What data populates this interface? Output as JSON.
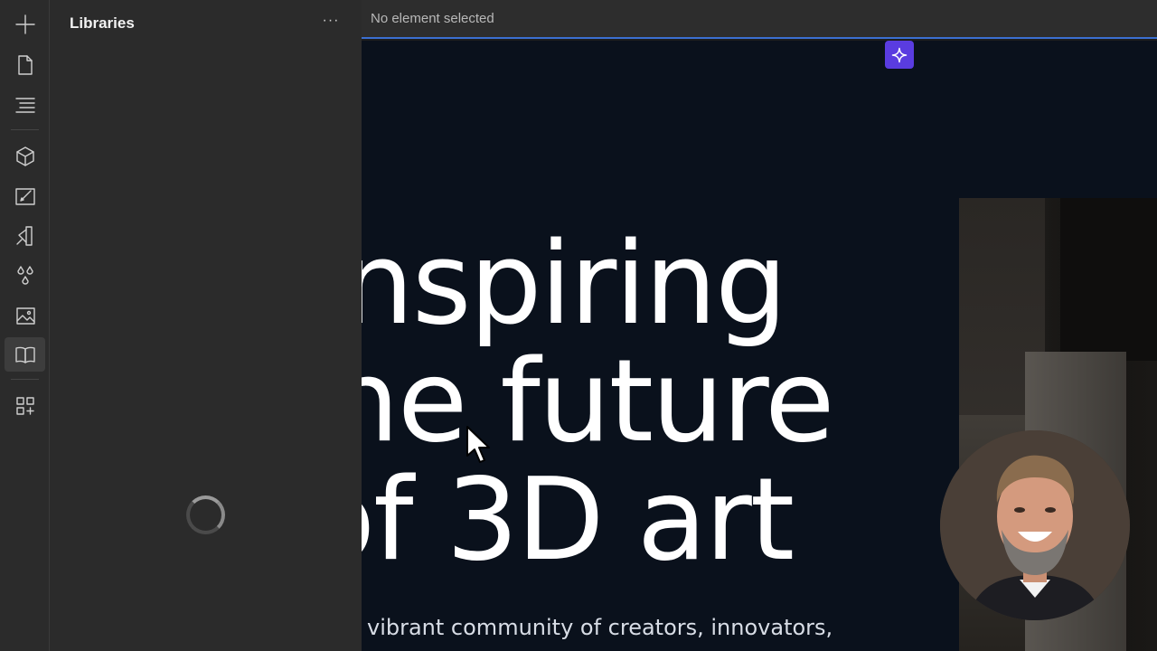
{
  "app": {
    "rail": {
      "items": [
        {
          "name": "add",
          "icon": "plus-icon"
        },
        {
          "name": "pages",
          "icon": "page-icon"
        },
        {
          "name": "navigator",
          "icon": "navigator-icon"
        },
        {
          "name": "components",
          "icon": "cube-icon"
        },
        {
          "name": "style-selectors",
          "icon": "brush-icon"
        },
        {
          "name": "cms",
          "icon": "swatch-icon"
        },
        {
          "name": "variables",
          "icon": "drops-icon"
        },
        {
          "name": "assets",
          "icon": "image-icon"
        },
        {
          "name": "libraries",
          "icon": "book-icon",
          "active": true
        },
        {
          "name": "apps",
          "icon": "apps-icon"
        }
      ]
    },
    "panel": {
      "title": "Libraries",
      "more": "···"
    },
    "topbar": {
      "status": "No element selected"
    },
    "canvas": {
      "headline": [
        "nspiring",
        "he future",
        "of 3D art"
      ],
      "subtext": "vibrant community of creators, innovators,"
    },
    "colors": {
      "accent": "#3b6fd1",
      "ai_button": "#5a3ce0",
      "canvas_bg": "#0a111c",
      "panel_bg": "#2b2b2b"
    }
  }
}
